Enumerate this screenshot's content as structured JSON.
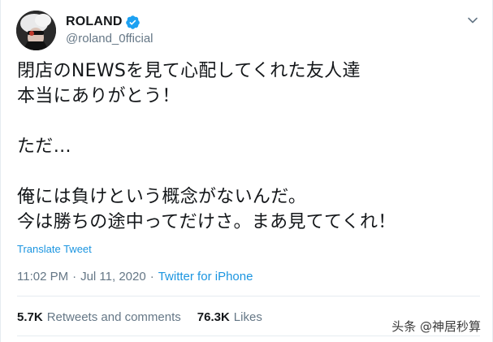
{
  "user": {
    "display_name": "ROLAND",
    "handle": "@roland_0fficial"
  },
  "icons": {
    "verified": "verified-badge-icon",
    "more": "chevron-down-icon"
  },
  "tweet": {
    "lines": [
      "閉店のNEWSを見て心配してくれた友人達",
      "本当にありがとう！",
      "",
      "ただ…",
      "",
      "俺には負けという概念がないんだ。",
      "今は勝ちの途中ってだけさ。まあ見ててくれ！"
    ],
    "translate_label": "Translate Tweet"
  },
  "meta": {
    "time": "11:02 PM",
    "separator": "·",
    "date": "Jul 11, 2020",
    "source": "Twitter for iPhone"
  },
  "stats": {
    "retweets_count": "5.7K",
    "retweets_label": "Retweets and comments",
    "likes_count": "76.3K",
    "likes_label": "Likes"
  },
  "watermark": "头条 @神居秒算",
  "colors": {
    "link": "#1b95e0",
    "secondary_text": "#657786",
    "primary_text": "#14171a",
    "divider": "#e6ecf0"
  }
}
